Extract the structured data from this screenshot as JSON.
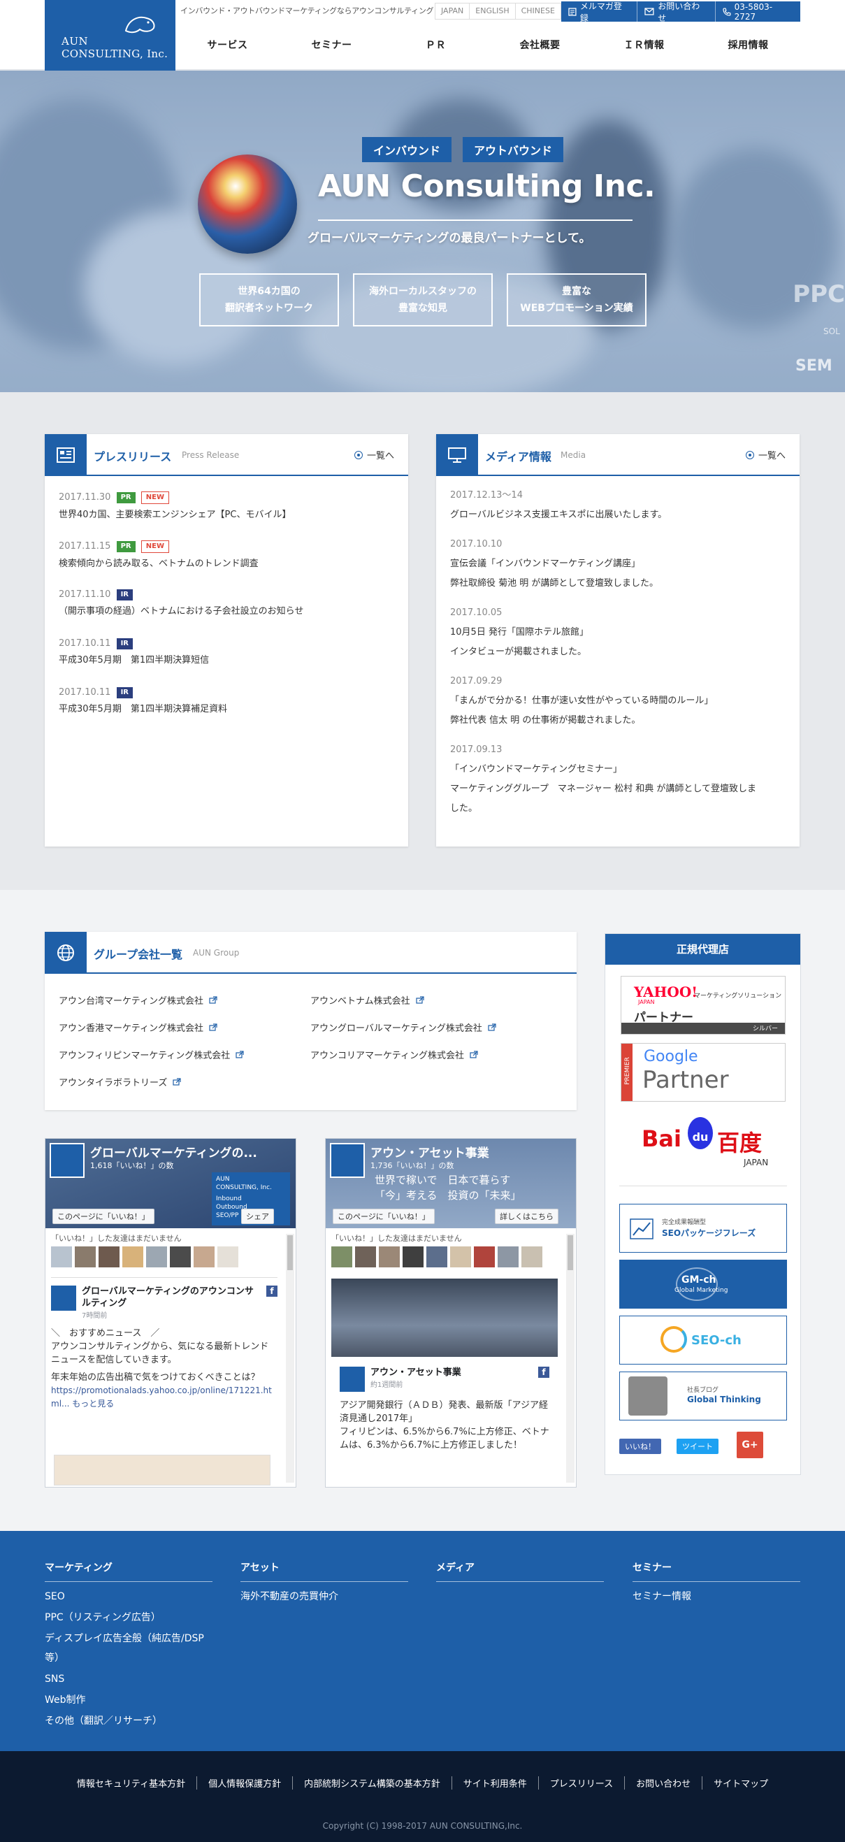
{
  "header": {
    "logo_line1": "AUN",
    "logo_line2": "CONSULTING, Inc.",
    "tagline": "インバウンド・アウトバウンドマーケティングならアウンコンサルティング",
    "langs": [
      "JAPAN",
      "ENGLISH",
      "CHINESE"
    ],
    "newsletter": "メルマガ登録",
    "contact": "お問い合わせ",
    "phone": "03-5803-2727",
    "nav": [
      "サービス",
      "セミナー",
      "ＰＲ",
      "会社概要",
      "ＩＲ情報",
      "採用情報"
    ]
  },
  "hero": {
    "tag1": "インバウンド",
    "tag2": "アウトバウンド",
    "title": "AUN Consulting Inc.",
    "subtitle": "グローバルマーケティングの最良パートナーとして。",
    "boxes": [
      {
        "l1": "世界64カ国の",
        "l2": "翻訳者ネットワーク"
      },
      {
        "l1": "海外ローカルスタッフの",
        "l2": "豊富な知見"
      },
      {
        "l1": "豊富な",
        "l2": "WEBプロモーション実績"
      }
    ],
    "bg_ppc": "PPC",
    "bg_sol": "SOL",
    "bg_sem": "SEM"
  },
  "press": {
    "title": "プレスリリース",
    "subtitle": "Press Release",
    "more": "一覧へ",
    "items": [
      {
        "date": "2017.11.30",
        "b1": "PR",
        "b2": "NEW",
        "text": "世界40カ国、主要検索エンジンシェア【PC、モバイル】"
      },
      {
        "date": "2017.11.15",
        "b1": "PR",
        "b2": "NEW",
        "text": "検索傾向から読み取る、ベトナムのトレンド調査"
      },
      {
        "date": "2017.11.10",
        "b1": "IR",
        "text": "（開示事項の経過）ベトナムにおける子会社設立のお知らせ"
      },
      {
        "date": "2017.10.11",
        "b1": "IR",
        "text": "平成30年5月期　第1四半期決算短信"
      },
      {
        "date": "2017.10.11",
        "b1": "IR",
        "text": "平成30年5月期　第1四半期決算補足資料"
      }
    ]
  },
  "media": {
    "title": "メディア情報",
    "subtitle": "Media",
    "more": "一覧へ",
    "items": [
      {
        "date": "2017.12.13〜14",
        "l1": "グローバルビジネス支援エキスポに出展いたします。"
      },
      {
        "date": "2017.10.10",
        "l1": "宣伝会議「インバウンドマーケティング講座」",
        "l2": "弊社取締役 菊池 明 が講師として登壇致しました。"
      },
      {
        "date": "2017.10.05",
        "l1": "10月5日 発行「国際ホテル旅館」",
        "l2": "インタビューが掲載されました。"
      },
      {
        "date": "2017.09.29",
        "l1": "「まんがで分かる！仕事が速い女性がやっている時間のルール」",
        "l2": "弊社代表 信太 明 の仕事術が掲載されました。"
      },
      {
        "date": "2017.09.13",
        "l1": "「インバウンドマーケティングセミナー」",
        "l2": "マーケティンググループ　マネージャー 松村 和典 が講師として登壇致しま",
        "l3": "した。"
      }
    ]
  },
  "group": {
    "title": "グループ会社一覧",
    "subtitle": "AUN Group",
    "links": [
      "アウン台湾マーケティング株式会社",
      "アウンベトナム株式会社",
      "アウン香港マーケティング株式会社",
      "アウングローバルマーケティング株式会社",
      "アウンフィリピンマーケティング株式会社",
      "アウンコリアマーケティング株式会社",
      "アウンタイラボラトリーズ"
    ]
  },
  "fb1": {
    "name": "グローバルマーケティングの...",
    "count": "1,618「いいね！」の数",
    "like": "このページに「いいね！」",
    "share": "シェア",
    "friends": "「いいね！」した友達はまだいません",
    "cover_l1": "AUN",
    "cover_l2": "CONSULTING, Inc.",
    "cover_l3": "Inbound",
    "cover_l4": "Outbound",
    "cover_l5": "SEO/PP",
    "post_name": "グローバルマーケティングのアウンコンサルティング",
    "post_time": "7時間前",
    "post_l1": "＼　おすすめニュース　／",
    "post_l2": "アウンコンサルティングから、気になる最新トレンドニュースを配信していきます。",
    "post_l3": "年末年始の広告出稿で気をつけておくべきことは？",
    "post_link": "https://promotionalads.yahoo.co.jp/online/171221.html",
    "post_more": "... もっと見る"
  },
  "fb2": {
    "name": "アウン・アセット事業",
    "count": "1,736「いいね！」の数",
    "cover_l1": "世界で稼いで　日本で暮らす",
    "cover_l2": "「今」考える　投資の「未来」",
    "like": "このページに「いいね！」",
    "detail": "詳しくはこちら",
    "friends": "「いいね！」した友達はまだいません",
    "post_name": "アウン・アセット事業",
    "post_time": "約1週間前",
    "post_l1": "アジア開発銀行（ＡＤＢ）発表、最新版「アジア経済見通し2017年」",
    "post_l2": "フィリピンは、6.5%から6.7%に上方修正、ベトナムは、6.3%から6.7%に上方修正しました！"
  },
  "agent": {
    "title": "正規代理店",
    "yahoo_l1": "YAHOO!",
    "yahoo_l2": "JAPAN",
    "yahoo_l3": "マーケティングソリューション",
    "yahoo_l4": "パートナー",
    "yahoo_l5": "シルバー",
    "google_l1": "Google",
    "google_l2": "Partner",
    "google_l3": "PREMIER",
    "baidu_l1": "Bai",
    "baidu_l2": "du",
    "baidu_l3": "百度",
    "baidu_l4": "JAPAN",
    "seo_pkg_l1": "完全成果報酬型",
    "seo_pkg_l2": "SEOパッケージフレーズ",
    "gmch_l1": "GM-ch",
    "gmch_l2": "Global Marketing",
    "seoch": "SEO-ch",
    "blog_l1": "社長ブログ",
    "blog_l2": "Global Thinking",
    "like": "いいね！",
    "tweet": "ツイート",
    "gplus": "G+"
  },
  "footer": {
    "cols": [
      {
        "head": "マーケティング",
        "links": [
          "SEO",
          "PPC（リスティング広告）",
          "ディスプレイ広告全般（純広告/DSP",
          "等）",
          "SNS",
          "Web制作",
          "その他（翻訳／リサーチ）"
        ]
      },
      {
        "head": "アセット",
        "links": [
          "海外不動産の売買仲介"
        ]
      },
      {
        "head": "メディア",
        "links": []
      },
      {
        "head": "セミナー",
        "links": [
          "セミナー情報"
        ]
      }
    ],
    "bottom_links": [
      "情報セキュリティ基本方針",
      "個人情報保護方針",
      "内部統制システム構築の基本方針",
      "サイト利用条件",
      "プレスリリース",
      "お問い合わせ",
      "サイトマップ"
    ],
    "copyright": "Copyright (C) 1998-2017 AUN CONSULTING,Inc."
  },
  "colors": {
    "brand": "#1e5fa8",
    "pr": "#3f9a3f",
    "ir": "#2b3e7e",
    "new": "#e0483a",
    "footer_dark": "#0c1a30"
  }
}
